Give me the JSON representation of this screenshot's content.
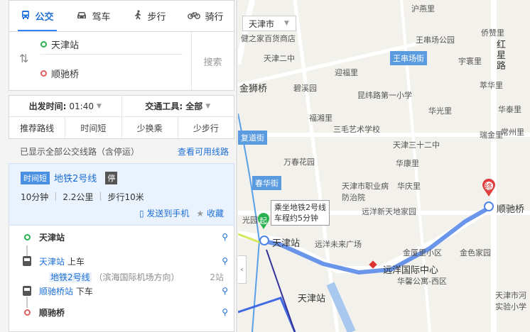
{
  "modes": [
    {
      "label": "公交",
      "icon": "bus-icon",
      "active": true
    },
    {
      "label": "驾车",
      "icon": "car-icon",
      "active": false
    },
    {
      "label": "步行",
      "icon": "walk-icon",
      "active": false
    },
    {
      "label": "骑行",
      "icon": "bike-icon",
      "active": false
    }
  ],
  "route": {
    "start": "天津站",
    "end": "顺驰桥",
    "search_label": "搜索"
  },
  "options": {
    "depart_label": "出发时间:",
    "depart_value": "01:40",
    "tool_label": "交通工具:",
    "tool_value": "全部",
    "tabs": [
      "推荐路线",
      "时间短",
      "少换乘",
      "少步行"
    ]
  },
  "info": {
    "shown": "已显示全部公交线路（含停运）",
    "view_link": "查看可用线路"
  },
  "plan": {
    "tag": "时间短",
    "line": "地铁2号线",
    "stop_tag": "停",
    "duration": "10分钟",
    "distance": "2.2公里",
    "walk": "步行10米",
    "send_phone": "发送到手机",
    "favorite": "收藏"
  },
  "steps": {
    "start": "天津站",
    "board_station": "天津站",
    "board_action": "上车",
    "line": "地铁2号线",
    "direction": "（滨海国际机场方向）",
    "stops": "2站",
    "alight_station": "顺驰桥站",
    "alight_action": "下车",
    "end": "顺驰桥"
  },
  "map": {
    "city": "天津市",
    "callout_line1": "乘坐地铁2号线",
    "callout_line2": "车程约5分钟",
    "start_marker": "起",
    "end_marker": "终",
    "labels": {
      "jianhua": "健之家百货商店",
      "tianer": "天津二中",
      "wangchuan": "王串场公园",
      "wangchuanjie": "王串场街",
      "yingfu": "迎福里",
      "yuguan": "宇寰里",
      "jinshi": "金狮桥",
      "beiping": "碧溪园",
      "kunwei": "昆纬路第一小学",
      "cuihua": "萃华里",
      "huaguang": "华光里",
      "huatai": "华泰里",
      "fuxiang": "福湘里",
      "sanmao": "三毛艺术学校",
      "ruijin": "瑞金里",
      "changzhou": "常州里",
      "jiaodao": "复道街",
      "wanjia": "万春花园",
      "tianjin32": "天津三十二中",
      "chunhua": "春华街",
      "huakang": "华康里",
      "vocational": "天津市职业病\n防治院",
      "huaqing": "华庆里",
      "yuanyang_new": "远洋新天地家园",
      "guangcheng": "光园",
      "tianjinzhan_map": "天津站",
      "yuanyang_future": "远洋未来广场",
      "jinxiaxiao": "金厦里小区",
      "jinse": "金色家园",
      "yuanyang_center": "远洋国际中心",
      "huayu": "华馨公寓-西区",
      "tianjinzhan_area": "天津站",
      "hongxing": "红\n星\n路",
      "shunchi": "顺驰桥",
      "tianjinhe": "天津市河\n实验小学",
      "qinyi": "侨赞里",
      "hubaixiao": "沪燕里"
    }
  }
}
